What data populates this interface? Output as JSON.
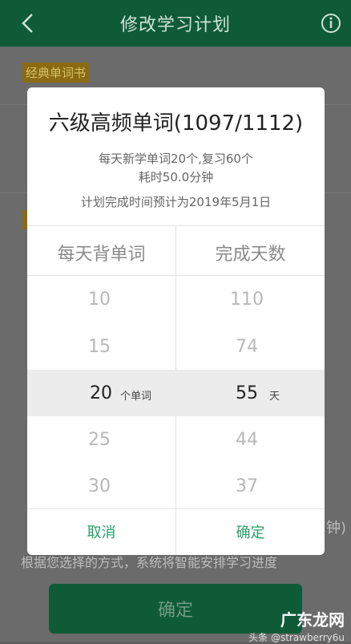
{
  "header": {
    "title": "修改学习计划",
    "back_icon": "chevron-left-icon",
    "info_icon": "info-circle-icon"
  },
  "background": {
    "tag": "经典单词书",
    "bracket": "钟)",
    "description": "根据您选择的方式，系统将智能安排学习进度",
    "confirm_label": "确定",
    "watermark_big": "广东龙网",
    "watermark_small": "头条 @strawberry6u"
  },
  "dialog": {
    "title": "六级高频单词(1097/1112)",
    "line1": "每天新学单词20个,复习60个",
    "line2": "耗时50.0分钟",
    "line3": "计划完成时间预计为2019年5月1日",
    "col_words": "每天背单词",
    "col_days": "完成天数",
    "words": [
      "10",
      "15",
      "20",
      "25",
      "30"
    ],
    "days": [
      "110",
      "74",
      "55",
      "44",
      "37"
    ],
    "word_unit": "个单词",
    "day_unit": "天",
    "cancel": "取消",
    "confirm": "确定"
  },
  "colors": {
    "header": "#0f5b38",
    "accent": "#2aa06a"
  }
}
